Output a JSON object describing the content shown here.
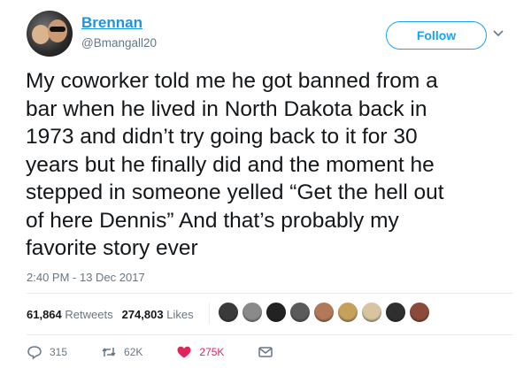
{
  "user": {
    "display_name": "Brennan",
    "handle": "@Bmangall20"
  },
  "header": {
    "follow_label": "Follow"
  },
  "tweet": {
    "text": "My coworker told me he got banned from a\nbar when he lived in North Dakota back in\n1973 and didn’t try going back to it for 30\nyears but he finally did and the moment he\nstepped in someone yelled “Get the hell out\nof here Dennis” And that’s probably my\nfavorite story ever",
    "timestamp": "2:40 PM - 13 Dec 2017"
  },
  "stats": {
    "retweets_count": "61,864",
    "retweets_label": "Retweets",
    "likes_count": "274,803",
    "likes_label": "Likes"
  },
  "likers": {
    "avatar_colors": [
      "#3a3a3a",
      "#8a8a8a",
      "#222222",
      "#5a5a5a",
      "#b07a5a",
      "#c6a15b",
      "#d8c4a0",
      "#2f2f2f",
      "#8b4a3a"
    ]
  },
  "actions": {
    "replies": "315",
    "retweets": "62K",
    "likes": "275K"
  },
  "colors": {
    "accent": "#1da1f2",
    "name": "#1b95e0",
    "like": "#e0245e",
    "muted": "#657786"
  }
}
